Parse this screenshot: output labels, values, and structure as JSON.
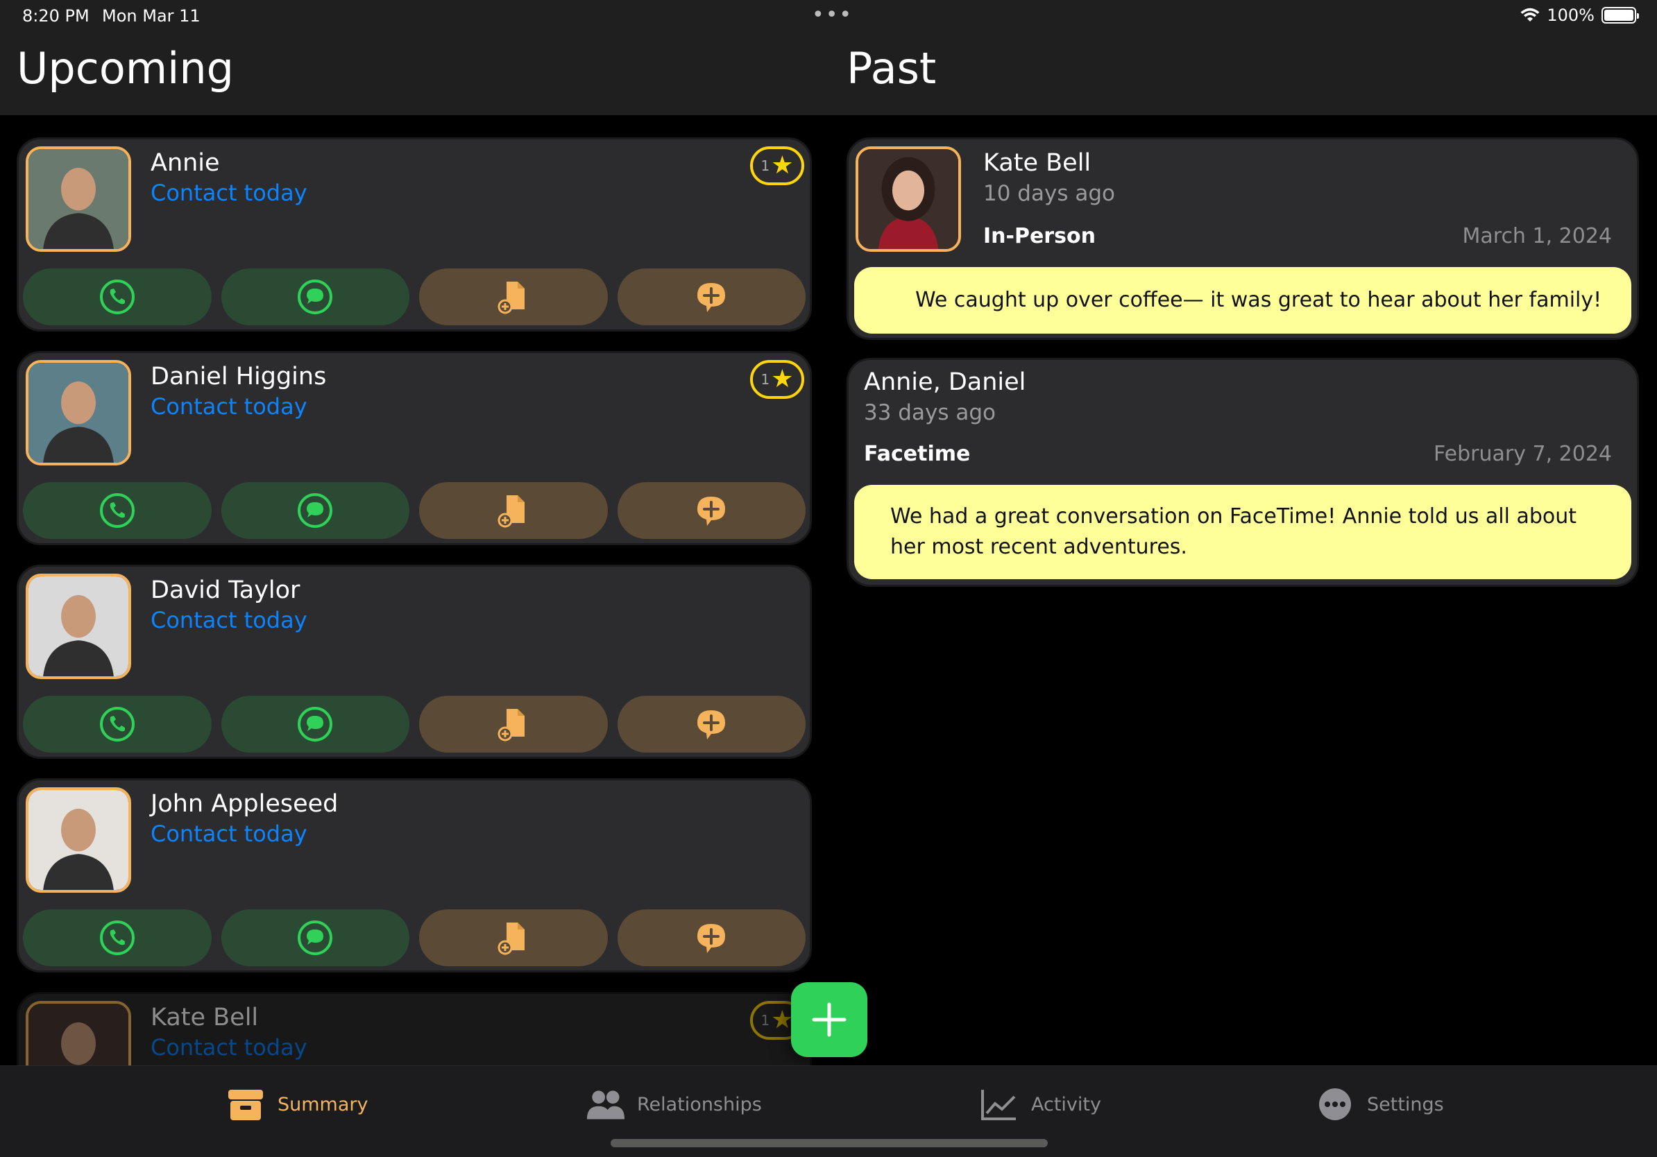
{
  "status_bar": {
    "time": "8:20 PM",
    "date": "Mon Mar 11",
    "battery": "100%"
  },
  "header": {
    "upcoming_title": "Upcoming",
    "past_title": "Past"
  },
  "upcoming": [
    {
      "name": "Annie",
      "status": "Contact today",
      "badge_count": "1",
      "has_badge": true,
      "avatar_color": "#6b7a6f"
    },
    {
      "name": "Daniel Higgins",
      "status": "Contact today",
      "badge_count": "1",
      "has_badge": true,
      "avatar_color": "#5d7f8a"
    },
    {
      "name": "David Taylor",
      "status": "Contact today",
      "has_badge": false,
      "avatar_color": "#d9d9d9"
    },
    {
      "name": "John Appleseed",
      "status": "Contact today",
      "has_badge": false,
      "avatar_color": "#e5e2dd"
    },
    {
      "name": "Kate Bell",
      "status": "Contact today",
      "badge_count": "1",
      "has_badge": true,
      "avatar_color": "#4a3a36"
    }
  ],
  "past": [
    {
      "name": "Kate Bell",
      "ago": "10 days ago",
      "type": "In-Person",
      "date": "March 1, 2024",
      "note": "We caught up over coffee— it was great to hear about her family!"
    },
    {
      "name": "Annie, Daniel",
      "ago": "33 days ago",
      "type": "Facetime",
      "date": "February 7, 2024",
      "note": "We had a great conversation on FaceTime! Annie told us all about her most recent adventures."
    }
  ],
  "tabs": [
    {
      "label": "Summary",
      "icon": "archive-box-icon",
      "active": true
    },
    {
      "label": "Relationships",
      "icon": "people-icon",
      "active": false
    },
    {
      "label": "Activity",
      "icon": "chart-line-icon",
      "active": false
    },
    {
      "label": "Settings",
      "icon": "ellipsis-circle-icon",
      "active": false
    }
  ],
  "colors": {
    "accent": "#f5b45c",
    "link": "#0a84ff",
    "green": "#30d158",
    "note_bg": "#ffff99",
    "badge": "#ffd60a"
  }
}
